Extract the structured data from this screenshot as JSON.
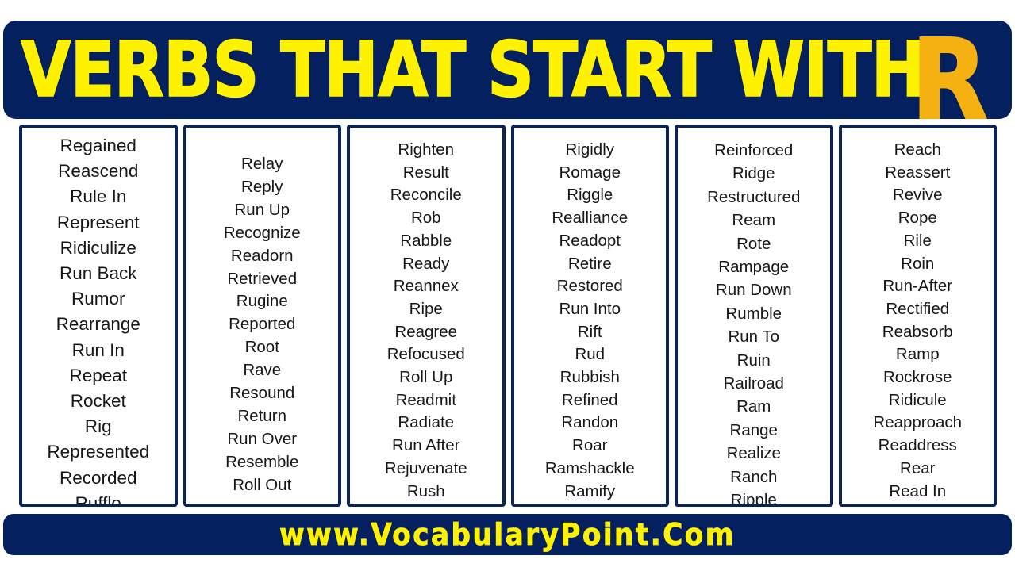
{
  "header": {
    "title": "VERBS THAT START WITH",
    "accent_letter": "R",
    "background_color": "#04205e",
    "title_color": "#fff200",
    "accent_letter_color": "#f5b111"
  },
  "footer": {
    "website": "www.VocabularyPoint.Com",
    "background_color": "#04205e",
    "text_color": "#fff200"
  },
  "columns": [
    {
      "index": 1,
      "words": [
        "Regained",
        "Reascend",
        "Rule In",
        "Represent",
        "Ridiculize",
        "Run Back",
        "Rumor",
        "Rearrange",
        "Run In",
        "Repeat",
        "Rocket",
        "Rig",
        "Represented",
        "Recorded",
        "Ruffle"
      ]
    },
    {
      "index": 2,
      "words": [
        "Relay",
        "Reply",
        "Run Up",
        "Recognize",
        "Readorn",
        "Retrieved",
        "Rugine",
        "Reported",
        "Root",
        "Rave",
        "Resound",
        "Return",
        "Run Over",
        "Resemble",
        "Roll Out"
      ]
    },
    {
      "index": 3,
      "words": [
        "Righten",
        "Result",
        "Reconcile",
        "Rob",
        "Rabble",
        "Ready",
        "Reannex",
        "Ripe",
        "Reagree",
        "Refocused",
        "Roll Up",
        "Readmit",
        "Radiate",
        "Run After",
        "Rejuvenate",
        "Rush"
      ]
    },
    {
      "index": 4,
      "words": [
        "Rigidly",
        "Romage",
        "Riggle",
        "Realliance",
        "Readopt",
        "Retire",
        "Restored",
        "Run Into",
        "Rift",
        "Rud",
        "Rubbish",
        "Refined",
        "Randon",
        "Roar",
        "Ramshackle",
        "Ramify"
      ]
    },
    {
      "index": 5,
      "words": [
        "Reinforced",
        "Ridge",
        "Restructured",
        "Ream",
        "Rote",
        "Rampage",
        "Run Down",
        "Rumble",
        "Run To",
        "Ruin",
        "Railroad",
        "Ram",
        "Range",
        "Realize",
        "Ranch",
        "Ripple"
      ]
    },
    {
      "index": 6,
      "words": [
        "Reach",
        "Reassert",
        "Revive",
        "Rope",
        "Rile",
        "Roin",
        "Run-After",
        "Rectified",
        "Reabsorb",
        "Ramp",
        "Rockrose",
        "Ridicule",
        "Reapproach",
        "Readdress",
        "Rear",
        "Read In"
      ]
    }
  ]
}
